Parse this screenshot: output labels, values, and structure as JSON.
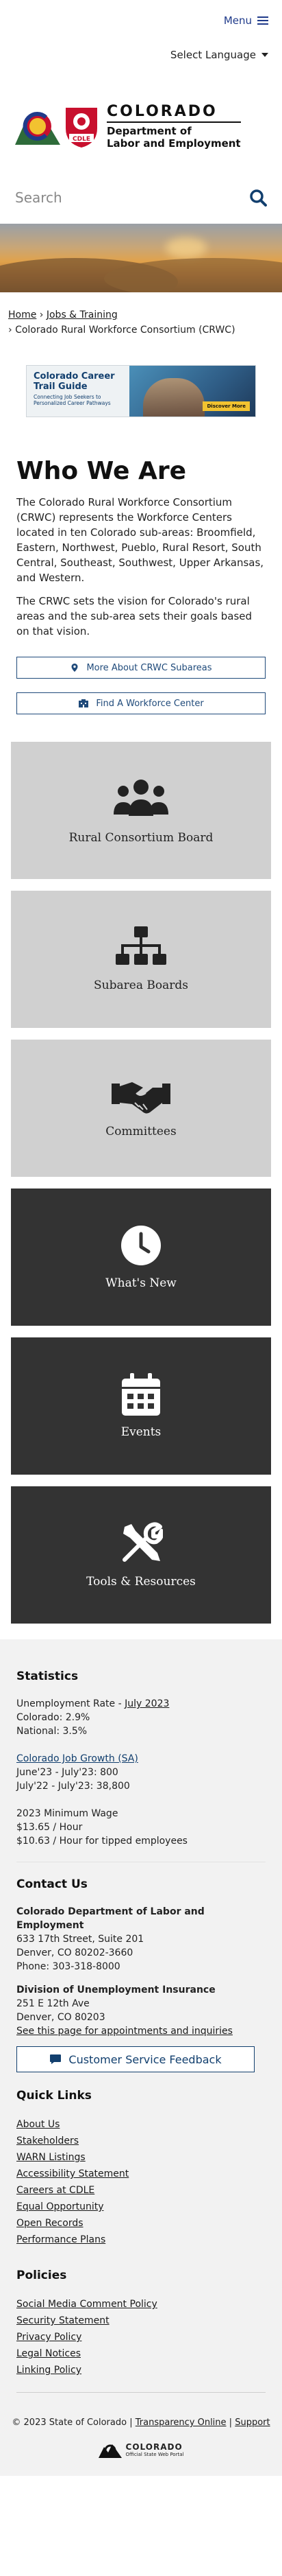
{
  "header": {
    "menu_label": "Menu",
    "language_label": "Select Language",
    "logo_state": "COLORADO",
    "logo_dept_line1": "Department of",
    "logo_dept_line2": "Labor and Employment",
    "logo_badge": "CDLE",
    "search_placeholder": "Search"
  },
  "breadcrumb": {
    "home": "Home",
    "sep1": "›",
    "jobs": "Jobs & Training",
    "sep2": "›",
    "current": "Colorado Rural Workforce Consortium (CRWC)"
  },
  "banner": {
    "title": "Colorado Career Trail Guide",
    "subtitle": "Connecting Job Seekers to Personalized Career Pathways",
    "cta": "Discover More"
  },
  "main": {
    "heading": "Who We Are",
    "para1": "The Colorado Rural Workforce Consortium (CRWC) represents the Workforce Centers located in ten Colorado sub-areas: Broomfield, Eastern, Northwest, Pueblo, Rural Resort, South Central, Southeast, Southwest, Upper Arkansas, and Western.",
    "para2": "The CRWC sets the vision for Colorado's rural areas and the sub-area sets their goals based on that vision.",
    "btn_subareas": "More About CRWC Subareas",
    "btn_find": "Find A Workforce Center"
  },
  "tiles": [
    {
      "label": "Rural Consortium Board",
      "icon": "people-group-icon"
    },
    {
      "label": "Subarea Boards",
      "icon": "org-chart-icon"
    },
    {
      "label": "Committees",
      "icon": "handshake-icon"
    },
    {
      "label": "What's New",
      "icon": "clock-icon"
    },
    {
      "label": "Events",
      "icon": "calendar-icon"
    },
    {
      "label": "Tools & Resources",
      "icon": "tools-icon"
    }
  ],
  "footer": {
    "stats_heading": "Statistics",
    "unemp_label": "Unemployment Rate - ",
    "unemp_link": "July 2023",
    "colorado_rate": "Colorado: 2.9%",
    "national_rate": "National: 3.5%",
    "job_growth_link": "Colorado Job Growth (SA)",
    "growth1": "June'23 - July'23: 800",
    "growth2": "July'22 - July'23: 38,800",
    "min_wage_label": "2023 Minimum Wage",
    "min_wage1": "$13.65 / Hour",
    "min_wage2": "$10.63 / Hour for tipped employees",
    "contact_heading": "Contact Us",
    "cdle_name": "Colorado Department of Labor and Employment",
    "cdle_addr1": "633 17th Street, Suite 201",
    "cdle_addr2": "Denver, CO  80202-3660",
    "cdle_phone": "Phone: 303-318-8000",
    "dui_name": "Division of Unemployment Insurance",
    "dui_addr1": "251 E 12th Ave",
    "dui_addr2": "Denver, CO  80203",
    "dui_link": "See this page for appointments and inquiries",
    "feedback_label": "Customer Service Feedback",
    "quick_heading": "Quick Links",
    "quick_links": [
      "About Us",
      "Stakeholders",
      "WARN Listings",
      "Accessibility Statement",
      "Careers at CDLE",
      "Equal Opportunity",
      "Open Records",
      "Performance Plans"
    ],
    "policies_heading": "Policies",
    "policy_links": [
      "Social Media Comment Policy",
      "Security Statement",
      "Privacy Policy",
      "Legal Notices",
      "Linking Policy"
    ],
    "copyright": "© 2023 State of Colorado",
    "sep": "|",
    "transparency": "Transparency Online",
    "support": "Support",
    "portal_name": "COLORADO",
    "portal_sub": "Official State Web Portal"
  }
}
